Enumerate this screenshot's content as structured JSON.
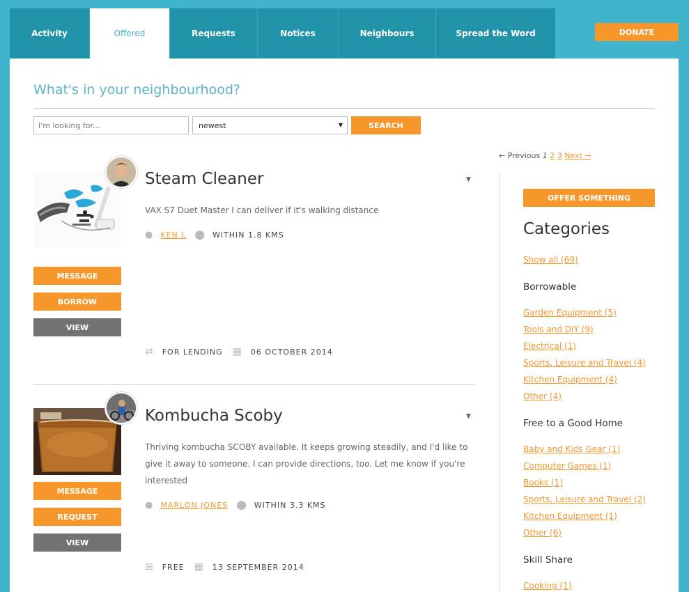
{
  "nav": {
    "tabs": [
      {
        "label": "Activity"
      },
      {
        "label": "Offered"
      },
      {
        "label": "Requests"
      },
      {
        "label": "Notices"
      },
      {
        "label": "Neighbours"
      },
      {
        "label": "Spread the Word"
      }
    ],
    "active_tab": "Offered",
    "donate_label": "DONATE"
  },
  "main": {
    "heading": "What's in your neighbourhood?",
    "search": {
      "placeholder": "I'm looking for...",
      "sort_value": "newest",
      "button_label": "SEARCH"
    },
    "pager": {
      "previous": "← Previous",
      "current": "1",
      "pages": [
        "2",
        "3"
      ],
      "next": "Next →"
    },
    "items": [
      {
        "title": "Steam Cleaner",
        "description": "VAX S7 Duet Master I can deliver if it's walking distance",
        "owner": "KEN L",
        "distance": "WITHIN 1.8 KMS",
        "buttons": [
          "MESSAGE",
          "BORROW",
          "VIEW"
        ],
        "type": "FOR LENDING",
        "date": "06 OCTOBER 2014"
      },
      {
        "title": "Kombucha Scoby",
        "description": "Thriving kombucha SCOBY available. It keeps growing steadily, and I'd like to give it away to someone. I can provide directions, too. Let me know if you're interested",
        "owner": "MARLON JONES",
        "distance": "WITHIN 3.3 KMS",
        "buttons": [
          "MESSAGE",
          "REQUEST",
          "VIEW"
        ],
        "type": "FREE",
        "date": "13 SEPTEMBER 2014"
      }
    ]
  },
  "sidebar": {
    "offer_button": "OFFER SOMETHING",
    "title": "Categories",
    "show_all": "Show all (69)",
    "groups": [
      {
        "name": "Borrowable",
        "links": [
          "Garden Equipment (5)",
          "Tools and DIY (9)",
          "Electrical (1)",
          "Sports, Leisure and Travel (4)",
          "Kitchen Equipment (4)",
          "Other (4)"
        ]
      },
      {
        "name": "Free to a Good Home",
        "links": [
          "Baby and Kids Gear (1)",
          "Computer Games (1)",
          "Books (1)",
          "Sports, Leisure and Travel (2)",
          "Kitchen Equipment (1)",
          "Other (6)"
        ]
      },
      {
        "name": "Skill Share",
        "links": [
          "Cooking (1)"
        ]
      }
    ]
  },
  "colors": {
    "background": "#3fb4cc",
    "nav": "#2193a8",
    "accent_orange": "#f7972b",
    "heading_blue": "#5bb4c9",
    "view_button": "#727272"
  }
}
